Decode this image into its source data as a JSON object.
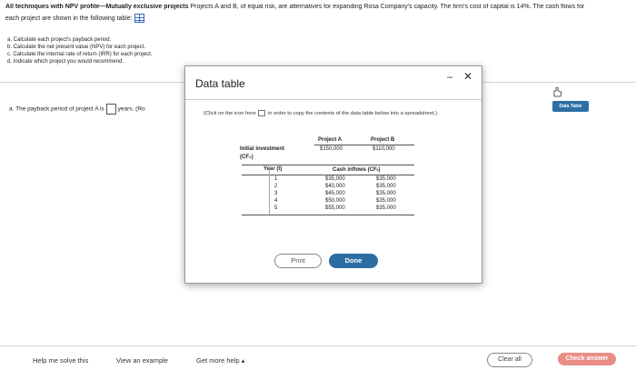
{
  "problem": {
    "title_bold": "All techniques with NPV profile—Mutually exclusive projects",
    "title_rest": " Projects A and B, of equal risk, are alternatives for expanding Rosa Company's capacity. The firm's cost of capital is 14%. The cash flows for",
    "line2": "each project are shown in the following table:",
    "tasks": [
      "a. Calculate each project's payback period.",
      "b. Calculate the net present value (NPV) for each project.",
      "c. Calculate the internal rate of return (IRR) for each project.",
      "d. Indicate which project you would recommend."
    ],
    "question_a_prefix": "a. The payback period of project A is",
    "question_a_suffix": "years. (Ro"
  },
  "data_table_badge": "Data Table",
  "bottom": {
    "help": "Help me solve this",
    "example": "View an example",
    "more_help": "Get more help ▴",
    "clear_all": "Clear all",
    "check_answer": "Check answer"
  },
  "modal": {
    "title": "Data table",
    "minimize": "–",
    "close": "✕",
    "instruction_pre": "(Click on the icon here",
    "instruction_post": "in order to copy the contents of the data table below into a spreadsheet.)",
    "col_a": "Project A",
    "col_b": "Project B",
    "initial_label": "Initial investment",
    "initial_sub": "(CF₀)",
    "initial_a": "$150,000",
    "initial_b": "$110,000",
    "year_header": "Year (t)",
    "cf_header": "Cash inflows (CFₜ)",
    "rows": [
      {
        "year": "1",
        "a": "$35,000",
        "b": "$35,000"
      },
      {
        "year": "2",
        "a": "$40,000",
        "b": "$35,000"
      },
      {
        "year": "3",
        "a": "$45,000",
        "b": "$35,000"
      },
      {
        "year": "4",
        "a": "$50,000",
        "b": "$35,000"
      },
      {
        "year": "5",
        "a": "$55,000",
        "b": "$35,000"
      }
    ],
    "print": "Print",
    "done": "Done"
  }
}
